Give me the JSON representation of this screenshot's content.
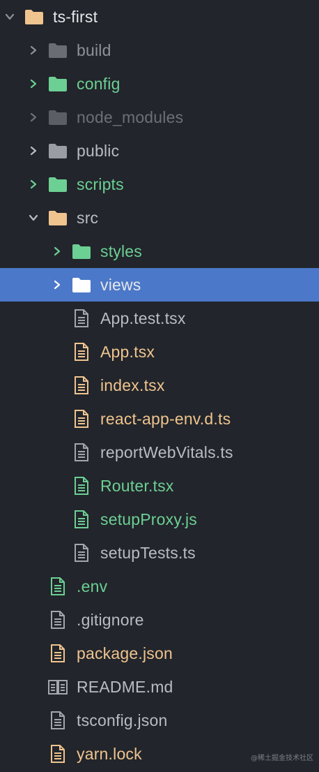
{
  "colors": {
    "background": "#22252b",
    "selection": "#4b78c9",
    "green": "#6ccf94",
    "orange": "#efc48f",
    "gray": "#8e9198",
    "white": "#e6e7ea"
  },
  "tree": [
    {
      "name": "ts-first",
      "type": "folder",
      "depth": 0,
      "expanded": true,
      "icon": "folder-icon",
      "color": "#efc48f",
      "text_class": "c-white",
      "chevron_class": "c-gray"
    },
    {
      "name": "build",
      "type": "folder",
      "depth": 1,
      "expanded": false,
      "icon": "folder-icon",
      "color": "#6a6d74",
      "text_class": "c-gray",
      "chevron_class": "c-gray"
    },
    {
      "name": "config",
      "type": "folder",
      "depth": 1,
      "expanded": false,
      "icon": "folder-icon",
      "color": "#6ccf94",
      "text_class": "c-green",
      "chevron_class": "c-green"
    },
    {
      "name": "node_modules",
      "type": "folder",
      "depth": 1,
      "expanded": false,
      "icon": "folder-icon",
      "color": "#5b5e65",
      "text_class": "c-dim",
      "chevron_class": "c-dim"
    },
    {
      "name": "public",
      "type": "folder",
      "depth": 1,
      "expanded": false,
      "icon": "folder-icon",
      "color": "#9a9da4",
      "text_class": "c-light",
      "chevron_class": "c-light"
    },
    {
      "name": "scripts",
      "type": "folder",
      "depth": 1,
      "expanded": false,
      "icon": "folder-icon",
      "color": "#6ccf94",
      "text_class": "c-green",
      "chevron_class": "c-green"
    },
    {
      "name": "src",
      "type": "folder",
      "depth": 1,
      "expanded": true,
      "icon": "folder-icon",
      "color": "#efc48f",
      "text_class": "c-light",
      "chevron_class": "c-light"
    },
    {
      "name": "styles",
      "type": "folder",
      "depth": 2,
      "expanded": false,
      "icon": "folder-icon",
      "color": "#6ccf94",
      "text_class": "c-green",
      "chevron_class": "c-green"
    },
    {
      "name": "views",
      "type": "folder",
      "depth": 2,
      "expanded": false,
      "selected": true,
      "icon": "folder-icon",
      "color": "#ffffff",
      "text_class": "c-white",
      "chevron_class": "c-white"
    },
    {
      "name": "App.test.tsx",
      "type": "file",
      "depth": 2,
      "icon": "file-icon",
      "color": "#a3a6ad",
      "text_class": "c-light"
    },
    {
      "name": "App.tsx",
      "type": "file",
      "depth": 2,
      "icon": "file-icon",
      "color": "#efc48f",
      "text_class": "c-orange"
    },
    {
      "name": "index.tsx",
      "type": "file",
      "depth": 2,
      "icon": "file-icon",
      "color": "#efc48f",
      "text_class": "c-orange"
    },
    {
      "name": "react-app-env.d.ts",
      "type": "file",
      "depth": 2,
      "icon": "file-icon",
      "color": "#efc48f",
      "text_class": "c-orange"
    },
    {
      "name": "reportWebVitals.ts",
      "type": "file",
      "depth": 2,
      "icon": "file-icon",
      "color": "#a3a6ad",
      "text_class": "c-light"
    },
    {
      "name": "Router.tsx",
      "type": "file",
      "depth": 2,
      "icon": "file-icon",
      "color": "#6ccf94",
      "text_class": "c-green"
    },
    {
      "name": "setupProxy.js",
      "type": "file",
      "depth": 2,
      "icon": "file-icon",
      "color": "#6ccf94",
      "text_class": "c-green"
    },
    {
      "name": "setupTests.ts",
      "type": "file",
      "depth": 2,
      "icon": "file-icon",
      "color": "#a3a6ad",
      "text_class": "c-light"
    },
    {
      "name": ".env",
      "type": "file",
      "depth": 1,
      "icon": "file-icon",
      "color": "#6ccf94",
      "text_class": "c-green"
    },
    {
      "name": ".gitignore",
      "type": "file",
      "depth": 1,
      "icon": "file-icon",
      "color": "#a3a6ad",
      "text_class": "c-light"
    },
    {
      "name": "package.json",
      "type": "file",
      "depth": 1,
      "icon": "file-icon",
      "color": "#efc48f",
      "text_class": "c-orange"
    },
    {
      "name": "README.md",
      "type": "file",
      "depth": 1,
      "icon": "book-icon",
      "color": "#a3a6ad",
      "text_class": "c-light"
    },
    {
      "name": "tsconfig.json",
      "type": "file",
      "depth": 1,
      "icon": "file-icon",
      "color": "#a3a6ad",
      "text_class": "c-light"
    },
    {
      "name": "yarn.lock",
      "type": "file",
      "depth": 1,
      "icon": "file-icon",
      "color": "#efc48f",
      "text_class": "c-orange"
    }
  ],
  "watermark": "@稀土掘金技术社区"
}
